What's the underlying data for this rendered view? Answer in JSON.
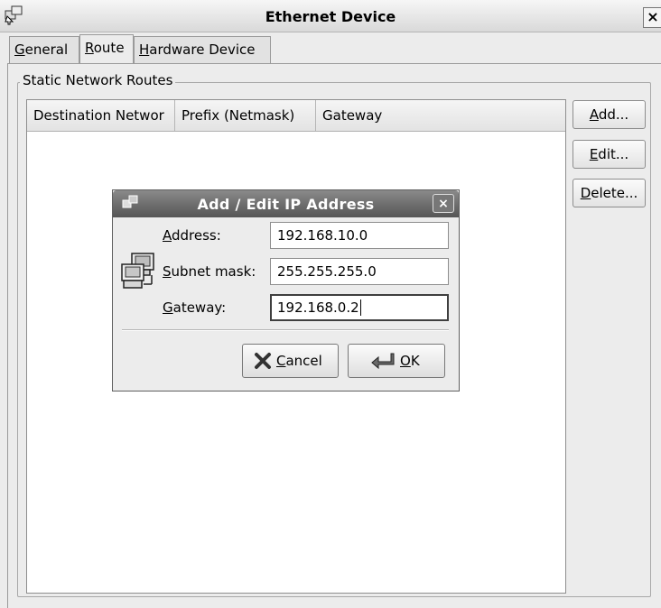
{
  "window": {
    "title": "Ethernet Device",
    "close_glyph": "×",
    "icon": "network-device-icon"
  },
  "tabs": [
    {
      "mnemonic": "G",
      "rest": "eneral",
      "active": false
    },
    {
      "mnemonic": "R",
      "rest": "oute",
      "active": true
    },
    {
      "mnemonic": "H",
      "rest": "ardware Device",
      "active": false
    }
  ],
  "group": {
    "legend": "Static Network Routes"
  },
  "table": {
    "columns": [
      "Destination Networ",
      "Prefix (Netmask)",
      "Gateway"
    ],
    "rows": []
  },
  "side_buttons": [
    {
      "mnemonic": "A",
      "rest": "dd..."
    },
    {
      "mnemonic": "E",
      "rest": "dit..."
    },
    {
      "mnemonic": "D",
      "rest": "elete..."
    }
  ],
  "dialog": {
    "title": "Add / Edit IP Address",
    "close_glyph": "×",
    "icon": "network-computers-icon",
    "fields": {
      "address": {
        "mnemonic": "A",
        "rest": "ddress:",
        "value": "192.168.10.0"
      },
      "subnet": {
        "mnemonic": "S",
        "rest": "ubnet mask:",
        "value": "255.255.255.0"
      },
      "gateway": {
        "mnemonic": "G",
        "rest": "ateway:",
        "value": "192.168.0.2"
      }
    },
    "buttons": {
      "cancel": {
        "mnemonic": "C",
        "rest": "ancel",
        "icon": "cancel-x-icon"
      },
      "ok": {
        "mnemonic": "O",
        "rest": "K",
        "icon": "ok-enter-icon"
      }
    }
  }
}
